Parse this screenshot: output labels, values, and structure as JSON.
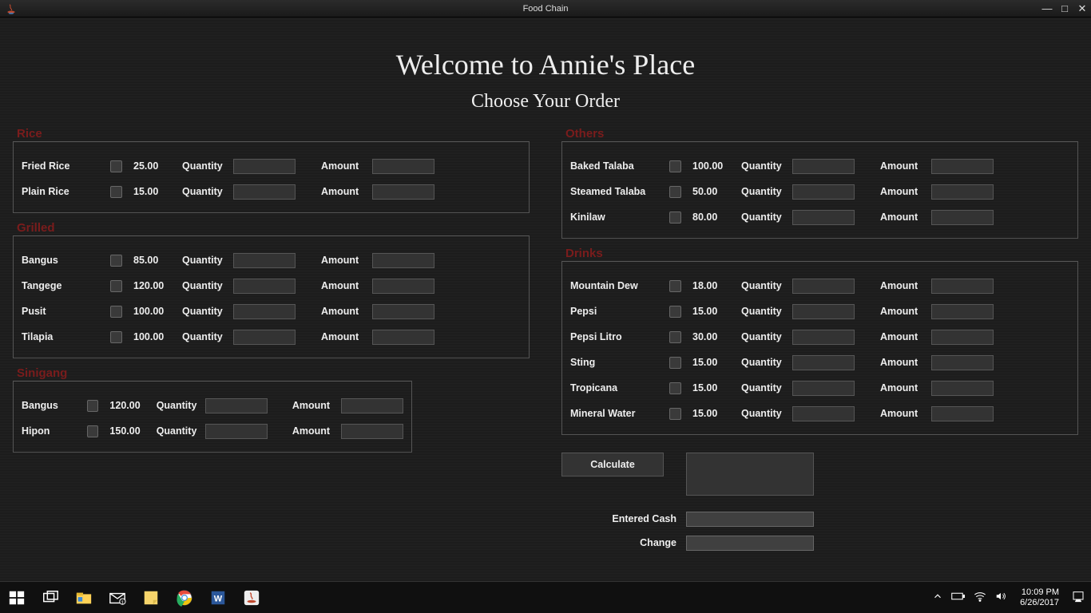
{
  "window": {
    "title": "Food Chain",
    "minimize": "—",
    "maximize": "□",
    "close": "✕"
  },
  "heading": {
    "title": "Welcome to Annie's Place",
    "subtitle": "Choose Your Order"
  },
  "labels": {
    "quantity": "Quantity",
    "amount": "Amount",
    "calculate": "Calculate",
    "entered_cash": "Entered Cash",
    "change": "Change"
  },
  "groups": {
    "rice": {
      "title": "Rice",
      "items": [
        {
          "name": "Fried Rice",
          "price": "25.00"
        },
        {
          "name": "Plain Rice",
          "price": "15.00"
        }
      ]
    },
    "grilled": {
      "title": "Grilled",
      "items": [
        {
          "name": "Bangus",
          "price": "85.00"
        },
        {
          "name": "Tangege",
          "price": "120.00"
        },
        {
          "name": "Pusit",
          "price": "100.00"
        },
        {
          "name": "Tilapia",
          "price": "100.00"
        }
      ]
    },
    "sinigang": {
      "title": "Sinigang",
      "items": [
        {
          "name": "Bangus",
          "price": "120.00"
        },
        {
          "name": "Hipon",
          "price": "150.00"
        }
      ]
    },
    "others": {
      "title": "Others",
      "items": [
        {
          "name": "Baked Talaba",
          "price": "100.00"
        },
        {
          "name": "Steamed Talaba",
          "price": "50.00"
        },
        {
          "name": "Kinilaw",
          "price": "80.00"
        }
      ]
    },
    "drinks": {
      "title": "Drinks",
      "items": [
        {
          "name": "Mountain Dew",
          "price": "18.00"
        },
        {
          "name": "Pepsi",
          "price": "15.00"
        },
        {
          "name": "Pepsi Litro",
          "price": "30.00"
        },
        {
          "name": "Sting",
          "price": "15.00"
        },
        {
          "name": "Tropicana",
          "price": "15.00"
        },
        {
          "name": "Mineral Water",
          "price": "15.00"
        }
      ]
    }
  },
  "taskbar": {
    "time": "10:09 PM",
    "date": "6/26/2017"
  }
}
